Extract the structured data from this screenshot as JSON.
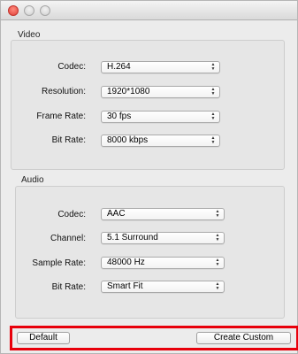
{
  "window": {
    "controls": [
      "close",
      "minimize",
      "maximize"
    ]
  },
  "video": {
    "title": "Video",
    "rows": [
      {
        "label": "Codec:",
        "value": "H.264"
      },
      {
        "label": "Resolution:",
        "value": "1920*1080"
      },
      {
        "label": "Frame Rate:",
        "value": "30 fps"
      },
      {
        "label": "Bit Rate:",
        "value": "8000 kbps"
      }
    ]
  },
  "audio": {
    "title": "Audio",
    "rows": [
      {
        "label": "Codec:",
        "value": "AAC"
      },
      {
        "label": "Channel:",
        "value": "5.1 Surround"
      },
      {
        "label": "Sample Rate:",
        "value": "48000 Hz"
      },
      {
        "label": "Bit Rate:",
        "value": "Smart Fit"
      }
    ]
  },
  "buttons": {
    "default_label": "Default",
    "create_label": "Create Custom"
  },
  "colors": {
    "highlight": "#e8000b",
    "window_bg": "#ececec"
  }
}
